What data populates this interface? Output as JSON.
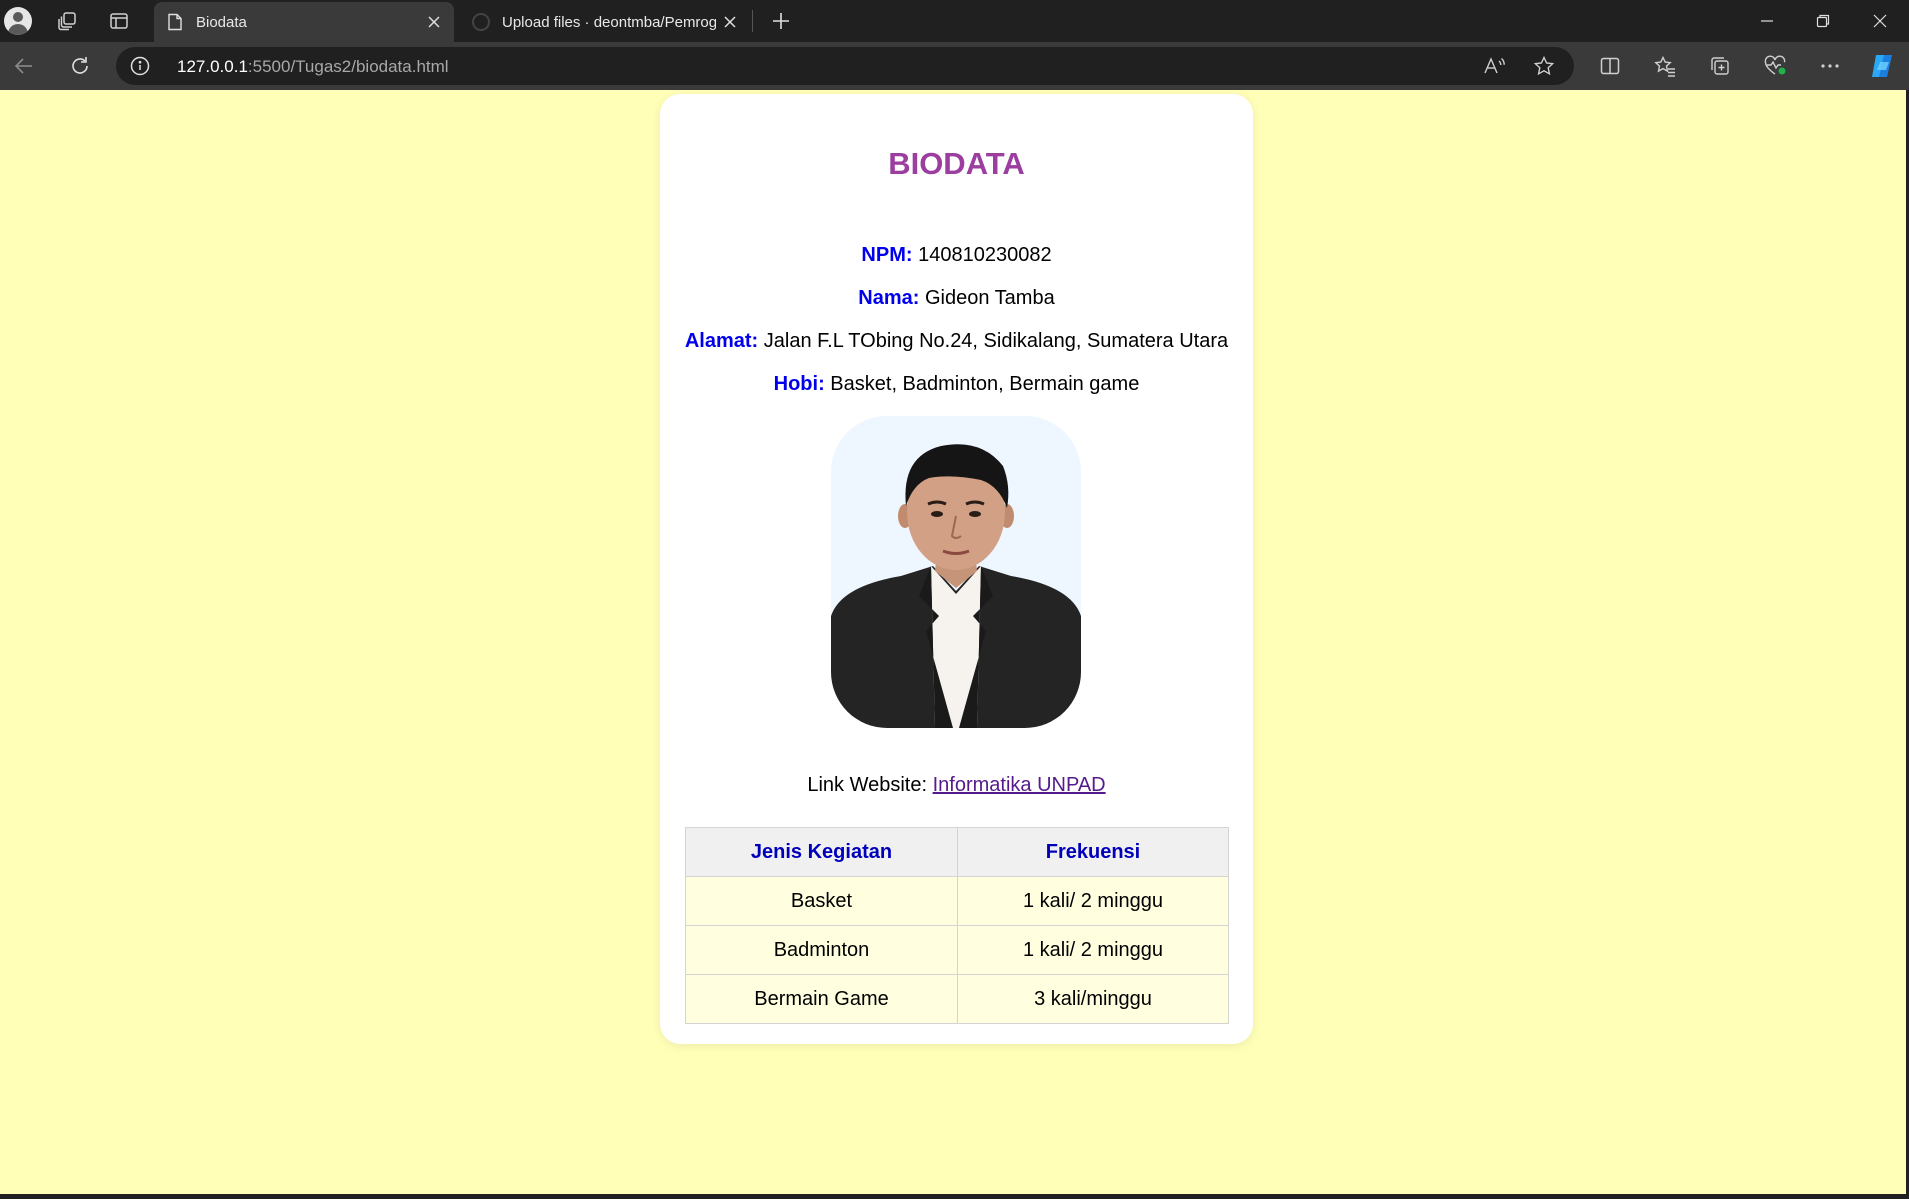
{
  "browser": {
    "tabs": [
      {
        "title": "Biodata",
        "active": true
      },
      {
        "title": "Upload files · deontmba/Pemrogr",
        "active": false
      }
    ],
    "address": {
      "host": "127.0.0.1",
      "rest": ":5500/Tugas2/biodata.html"
    },
    "icons": {
      "profile": "profile-avatar-icon",
      "workspaces": "workspaces-icon",
      "tab_actions": "tab-actions-icon",
      "back": "back-arrow-icon",
      "refresh": "refresh-icon",
      "info": "info-icon",
      "read_aloud": "read-aloud-icon",
      "favorite": "star-icon",
      "split": "split-screen-icon",
      "favorites": "favorites-icon",
      "collections": "collections-icon",
      "health": "browser-essentials-icon",
      "more": "more-icon",
      "copilot": "copilot-icon"
    }
  },
  "page": {
    "heading": "BIODATA",
    "fields": {
      "npm": {
        "label": "NPM:",
        "value": "140810230082"
      },
      "nama": {
        "label": "Nama:",
        "value": "Gideon Tamba"
      },
      "alamat": {
        "label": "Alamat:",
        "value": "Jalan F.L TObing No.24, Sidikalang, Sumatera Utara"
      },
      "hobi": {
        "label": "Hobi:",
        "value": "Basket, Badminton, Bermain game"
      }
    },
    "link": {
      "prefix": "Link Website:",
      "text": "Informatika UNPAD"
    },
    "table": {
      "headers": [
        "Jenis Kegiatan",
        "Frekuensi"
      ],
      "rows": [
        [
          "Basket",
          "1 kali/ 2 minggu"
        ],
        [
          "Badminton",
          "1 kali/ 2 minggu"
        ],
        [
          "Bermain Game",
          "3 kali/minggu"
        ]
      ]
    }
  },
  "colors": {
    "page_bg": "#ffffb8",
    "heading": "#9b3ea0",
    "label": "#0000ee",
    "table_header_text": "#0000bb",
    "table_cell_bg": "#ffffe0"
  }
}
